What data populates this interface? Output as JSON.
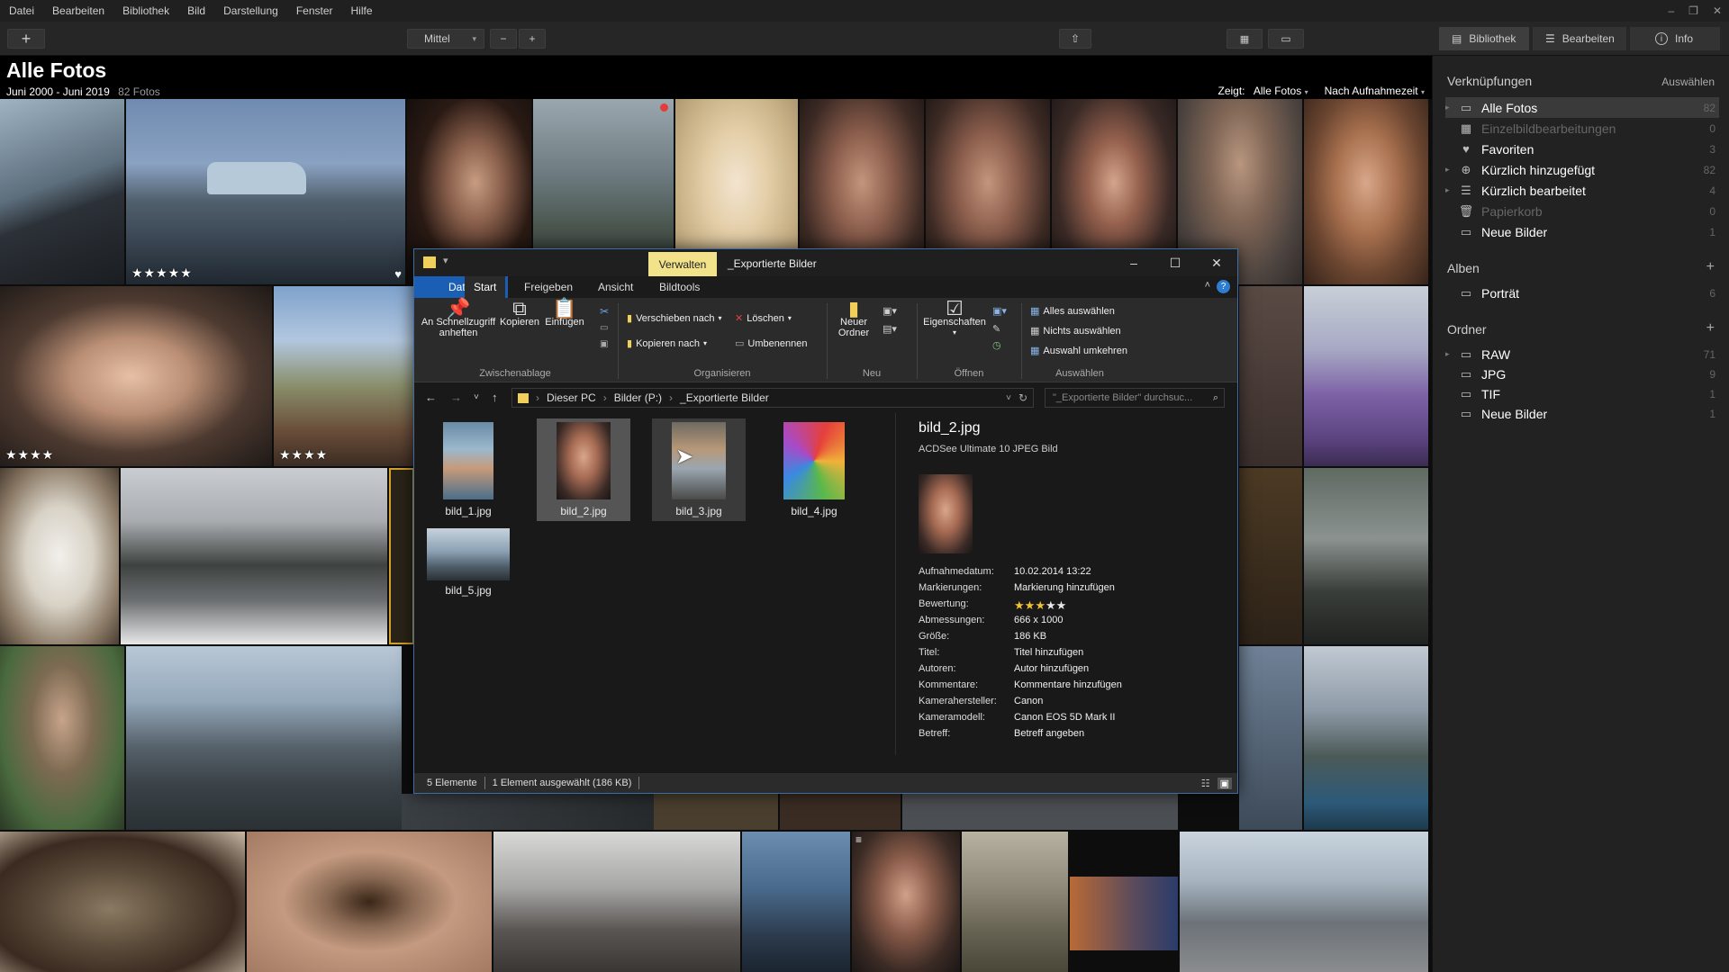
{
  "menubar": [
    "Datei",
    "Bearbeiten",
    "Bibliothek",
    "Bild",
    "Darstellung",
    "Fenster",
    "Hilfe"
  ],
  "toolbar": {
    "add": "+",
    "size_select": "Mittel",
    "zoom_out": "−",
    "zoom_in": "+",
    "modes": [
      {
        "label": "Bibliothek",
        "icon": "library-icon"
      },
      {
        "label": "Bearbeiten",
        "icon": "sliders-icon"
      },
      {
        "label": "Info",
        "icon": "info-icon"
      }
    ]
  },
  "header": {
    "title": "Alle Fotos",
    "date_range": "Juni 2000 - Juni 2019",
    "count": "82 Fotos",
    "filter_label": "Zeigt:",
    "filter_value": "Alle Fotos",
    "sort_value": "Nach Aufnahmezeit"
  },
  "grid": {
    "ratings": [
      "★★★★★",
      "★★★★",
      "★★★★"
    ]
  },
  "sidebar": {
    "links_title": "Verknüpfungen",
    "links_action": "Auswählen",
    "links": [
      {
        "label": "Alle Fotos",
        "count": "82"
      },
      {
        "label": "Einzelbildbearbeitungen",
        "count": "0"
      },
      {
        "label": "Favoriten",
        "count": "3"
      },
      {
        "label": "Kürzlich hinzugefügt",
        "count": "82"
      },
      {
        "label": "Kürzlich bearbeitet",
        "count": "4"
      },
      {
        "label": "Papierkorb",
        "count": "0"
      },
      {
        "label": "Neue Bilder",
        "count": "1"
      }
    ],
    "albums_title": "Alben",
    "albums": [
      {
        "label": "Porträt",
        "count": "6"
      }
    ],
    "folders_title": "Ordner",
    "folders": [
      {
        "label": "RAW",
        "count": "71"
      },
      {
        "label": "JPG",
        "count": "9"
      },
      {
        "label": "TIF",
        "count": "1"
      },
      {
        "label": "Neue Bilder",
        "count": "1"
      }
    ]
  },
  "explorer": {
    "manage_tab": "Verwalten",
    "window_title": "_Exportierte Bilder",
    "ribbon_tabs": [
      "Datei",
      "Start",
      "Freigeben",
      "Ansicht",
      "Bildtools"
    ],
    "ribbon": {
      "pin": "An Schnellzugriff anheften",
      "copy": "Kopieren",
      "paste": "Einfügen",
      "clipboard": "Zwischenablage",
      "move_to": "Verschieben nach",
      "copy_to": "Kopieren nach",
      "delete": "Löschen",
      "rename": "Umbenennen",
      "organize": "Organisieren",
      "new_folder": "Neuer Ordner",
      "new": "Neu",
      "properties": "Eigenschaften",
      "open": "Öffnen",
      "select_all": "Alles auswählen",
      "select_none": "Nichts auswählen",
      "invert": "Auswahl umkehren",
      "select": "Auswählen"
    },
    "address": [
      "Dieser PC",
      "Bilder (P:)",
      "_Exportierte Bilder"
    ],
    "search_placeholder": "\"_Exportierte Bilder\" durchsuc...",
    "files": [
      "bild_1.jpg",
      "bild_2.jpg",
      "bild_3.jpg",
      "bild_4.jpg",
      "bild_5.jpg"
    ],
    "preview": {
      "name": "bild_2.jpg",
      "type": "ACDSee Ultimate 10 JPEG Bild",
      "rows": [
        {
          "k": "Aufnahmedatum:",
          "v": "10.02.2014 13:22"
        },
        {
          "k": "Markierungen:",
          "v": "Markierung hinzufügen"
        },
        {
          "k": "Bewertung:",
          "v": ""
        },
        {
          "k": "Abmessungen:",
          "v": "666 x 1000"
        },
        {
          "k": "Größe:",
          "v": "186 KB"
        },
        {
          "k": "Titel:",
          "v": "Titel hinzufügen"
        },
        {
          "k": "Autoren:",
          "v": "Autor hinzufügen"
        },
        {
          "k": "Kommentare:",
          "v": "Kommentare hinzufügen"
        },
        {
          "k": "Kamerahersteller:",
          "v": "Canon"
        },
        {
          "k": "Kameramodell:",
          "v": "Canon EOS 5D Mark II"
        },
        {
          "k": "Betreff:",
          "v": "Betreff angeben"
        }
      ],
      "rating": 3
    },
    "status_items": "5 Elemente",
    "status_selected": "1 Element ausgewählt (186 KB)",
    "accent": "#1a5fb4",
    "manage_color": "#f2e28a"
  }
}
